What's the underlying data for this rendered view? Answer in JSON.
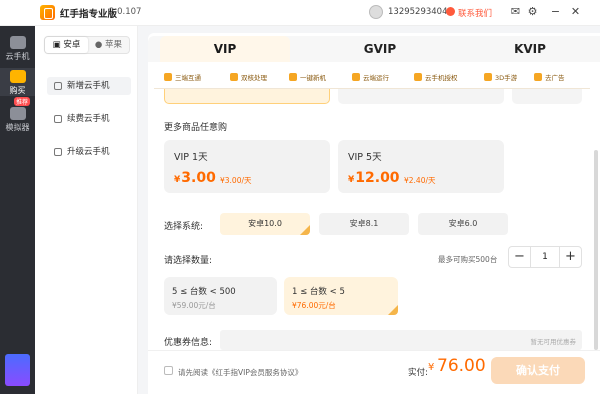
{
  "app": {
    "title": "红手指专业版",
    "version": "2.0.107"
  },
  "user": {
    "phone": "13295293404",
    "service_label": "联系我们"
  },
  "rail": {
    "items": [
      {
        "label": "云手机"
      },
      {
        "label": "购买"
      },
      {
        "label": "模拟器"
      }
    ],
    "badge": "推荐"
  },
  "sidebar": {
    "os_tabs": [
      "安卓",
      "苹果"
    ],
    "menu": [
      {
        "label": "新增云手机"
      },
      {
        "label": "续费云手机"
      },
      {
        "label": "升级云手机"
      }
    ]
  },
  "tabs": [
    {
      "label": "VIP"
    },
    {
      "label": "GVIP"
    },
    {
      "label": "KVIP"
    }
  ],
  "features": [
    {
      "label": "三端互通",
      "icon": "devices-icon"
    },
    {
      "label": "双核处理",
      "icon": "cpu-icon"
    },
    {
      "label": "一键新机",
      "icon": "refresh-phone-icon"
    },
    {
      "label": "云端运行",
      "icon": "cloud-icon"
    },
    {
      "label": "云手机授权",
      "icon": "key-icon"
    },
    {
      "label": "3D手游",
      "icon": "gamepad-icon"
    },
    {
      "label": "去广告",
      "icon": "no-ads-icon"
    }
  ],
  "more_section": {
    "title": "更多商品任意购"
  },
  "products": [
    {
      "name": "VIP 1天",
      "currency": "¥",
      "price": "3.00",
      "per_day": "¥3.00/天"
    },
    {
      "name": "VIP 5天",
      "currency": "¥",
      "price": "12.00",
      "per_day": "¥2.40/天"
    }
  ],
  "system": {
    "label": "选择系统:",
    "options": [
      "安卓10.0",
      "安卓8.1",
      "安卓6.0"
    ],
    "selected": "安卓10.0"
  },
  "quantity": {
    "label": "请选择数量:",
    "max_note": "最多可购买500台",
    "minus": "−",
    "value": "1",
    "plus": "+"
  },
  "tiers": [
    {
      "range": "5 ≤ 台数 < 500",
      "price": "¥59.00元/台"
    },
    {
      "range": "1 ≤ 台数 < 5",
      "price": "¥76.00元/台"
    }
  ],
  "coupon": {
    "label": "优惠券信息:",
    "placeholder": "暂无可用优惠券"
  },
  "footer": {
    "agree_text": "请先阅读《红手指VIP会员服务协议》",
    "total_label": "实付:",
    "currency": "¥",
    "total": "76.00",
    "pay_button": "确认支付"
  },
  "colors": {
    "accent": "#ff6a00",
    "selected_bg": "#fff3dd",
    "rail_bg": "#2b2d33"
  }
}
